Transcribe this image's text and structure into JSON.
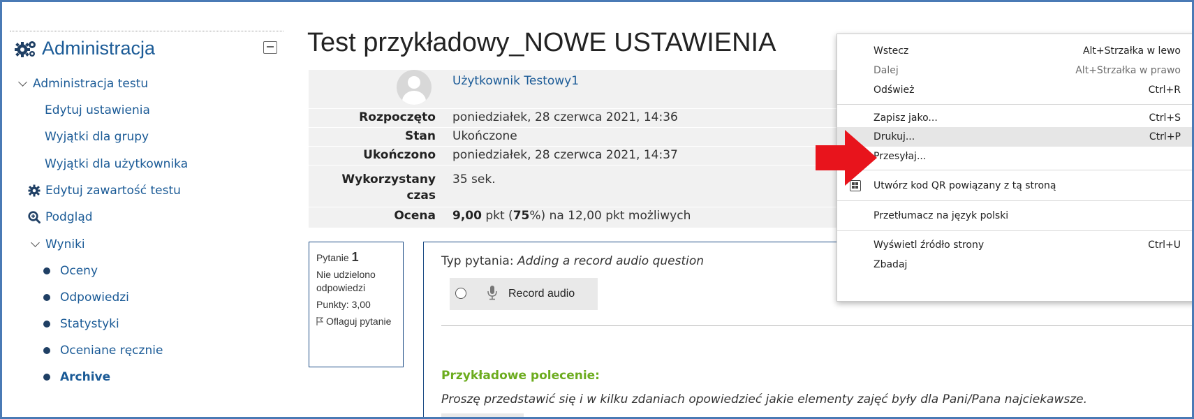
{
  "sidebar": {
    "title": "Administracja",
    "items": [
      {
        "label": "Administracja testu"
      },
      {
        "label": "Edytuj ustawienia"
      },
      {
        "label": "Wyjątki dla grupy"
      },
      {
        "label": "Wyjątki dla użytkownika"
      },
      {
        "label": "Edytuj zawartość testu"
      },
      {
        "label": "Podgląd"
      },
      {
        "label": "Wyniki"
      },
      {
        "label": "Oceny"
      },
      {
        "label": "Odpowiedzi"
      },
      {
        "label": "Statystyki"
      },
      {
        "label": "Oceniane ręcznie"
      },
      {
        "label": "Archive"
      }
    ]
  },
  "main": {
    "title": "Test przykładowy_NOWE USTAWIENIA",
    "user_link": "Użytkownik Testowy1",
    "summary": [
      {
        "label": "Rozpoczęto",
        "value": "poniedziałek, 28 czerwca 2021, 14:36"
      },
      {
        "label": "Stan",
        "value": "Ukończone"
      },
      {
        "label": "Ukończono",
        "value": "poniedziałek, 28 czerwca 2021, 14:37"
      },
      {
        "label_line1": "Wykorzystany",
        "label_line2": "czas",
        "value": "35 sek."
      },
      {
        "label": "Ocena",
        "value_bold1": "9,00",
        "value_mid1": " pkt (",
        "value_bold2": "75",
        "value_mid2": "%) na 12,00 pkt możliwych"
      }
    ],
    "question_info": {
      "prefix": "Pytanie ",
      "number": "1",
      "status": "Nie udzielono odpowiedzi",
      "points": "Punkty: 3,00",
      "flag": "Oflaguj pytanie"
    },
    "question": {
      "type_prefix": "Typ pytania: ",
      "type_value": "Adding a record audio question",
      "record_label": "Record audio",
      "heading": "Przykładowe polecenie:",
      "text": "Proszę przedstawić się i w kilku zdaniach opowiedzieć  jakie elementy zajęć były dla Pani/Pana najciekawsze."
    }
  },
  "context_menu": {
    "items": [
      {
        "label": "Wstecz",
        "shortcut": "Alt+Strzałka w lewo"
      },
      {
        "label": "Dalej",
        "shortcut": "Alt+Strzałka w prawo",
        "disabled": true
      },
      {
        "label": "Odśwież",
        "shortcut": "Ctrl+R"
      },
      {
        "label": "Zapisz jako...",
        "shortcut": "Ctrl+S"
      },
      {
        "label": "Drukuj...",
        "shortcut": "Ctrl+P",
        "highlighted": true
      },
      {
        "label": "Przesyłaj...",
        "shortcut": ""
      },
      {
        "label": "Utwórz kod QR powiązany z tą stroną",
        "shortcut": "",
        "icon": "qr-code-icon"
      },
      {
        "label": "Przetłumacz na język polski",
        "shortcut": ""
      },
      {
        "label": "Wyświetl źródło strony",
        "shortcut": "Ctrl+U"
      },
      {
        "label": "Zbadaj",
        "shortcut": ""
      }
    ]
  },
  "colors": {
    "link": "#1a5a96",
    "accent_green": "#6cac1e",
    "arrow_red": "#e8141c",
    "frame": "#4a7ab5"
  }
}
